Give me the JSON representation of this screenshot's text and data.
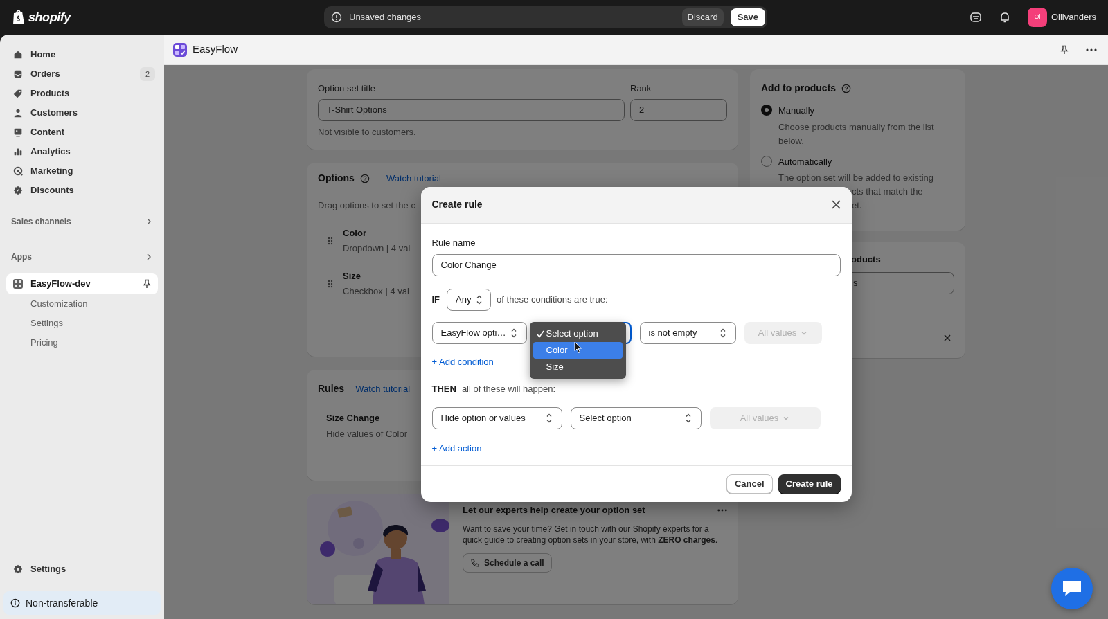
{
  "top_bar": {
    "brand": "shopify",
    "unsaved": {
      "message": "Unsaved changes",
      "discard": "Discard",
      "save": "Save"
    },
    "store": {
      "initials": "Ol",
      "name": "Ollivanders"
    }
  },
  "sidebar": {
    "items": [
      {
        "label": "Home",
        "selected": false
      },
      {
        "label": "Orders",
        "badge": "2",
        "selected": false
      },
      {
        "label": "Products",
        "selected": false
      },
      {
        "label": "Customers",
        "selected": false
      },
      {
        "label": "Content",
        "selected": false
      },
      {
        "label": "Analytics",
        "selected": false
      },
      {
        "label": "Marketing",
        "selected": false
      },
      {
        "label": "Discounts",
        "selected": false
      }
    ],
    "sections": [
      {
        "label": "Sales channels"
      },
      {
        "label": "Apps"
      }
    ],
    "app": {
      "label": "EasyFlow-dev",
      "selected": true,
      "children": [
        {
          "label": "Customization"
        },
        {
          "label": "Settings"
        },
        {
          "label": "Pricing"
        }
      ]
    },
    "settings": "Settings",
    "notice": "Non-transferable"
  },
  "app_header": {
    "title": "EasyFlow"
  },
  "option_set_card": {
    "title_label": "Option set title",
    "title_value": "T-Shirt Options",
    "rank_label": "Rank",
    "rank_value": "2",
    "help": "Not visible to customers."
  },
  "options_card": {
    "heading": "Options",
    "link": "Watch tutorial",
    "hint": "Drag options to set the c",
    "options": [
      {
        "name": "Color",
        "detail": "Dropdown | 4 val"
      },
      {
        "name": "Size",
        "detail": "Checkbox | 4 val"
      }
    ]
  },
  "rules_card": {
    "heading": "Rules",
    "link": "Watch tutorial",
    "rules": [
      {
        "name": "Size Change",
        "detail": "Hide values of Color"
      }
    ]
  },
  "expert_card": {
    "title": "Let our experts help create your option set",
    "body": "Want to save your time? Get in touch with our Shopify experts for a quick guide to creating option sets in your store, with **ZERO charges**.",
    "button": "Schedule a call"
  },
  "add_to_products": {
    "heading": "Add to products",
    "choices": [
      {
        "label": "Manually",
        "description": [
          "Choose products manually from the list",
          "below."
        ],
        "selected": true
      },
      {
        "label": "Automatically",
        "description": [
          "The option set will be added to existing",
          "cts that match the",
          "et."
        ],
        "selected": false
      }
    ]
  },
  "products_card": {
    "heading": "oducts",
    "field_value": "s"
  },
  "modal": {
    "title": "Create rule",
    "rule_name_label": "Rule name",
    "rule_name_value": "Color Change",
    "if_label": "IF",
    "match": "Any",
    "condition_text": "of these conditions are true:",
    "conditions": [
      {
        "source": "EasyFlow opti…",
        "option_menu": [
          {
            "label": "Select option",
            "checked": true,
            "selected": false
          },
          {
            "label": "Color",
            "checked": false,
            "selected": true
          },
          {
            "label": "Size",
            "checked": false,
            "selected": false
          }
        ],
        "operator": "is not empty",
        "values": "All values",
        "values_disabled": true
      }
    ],
    "add_condition": "+ Add condition",
    "then_label": "THEN",
    "then_text": "all of these will happen:",
    "actions": [
      {
        "action": "Hide option or values",
        "option": "Select option",
        "values": "All values",
        "values_disabled": true
      }
    ],
    "add_action": "+ Add action",
    "cancel": "Cancel",
    "submit": "Create rule"
  }
}
